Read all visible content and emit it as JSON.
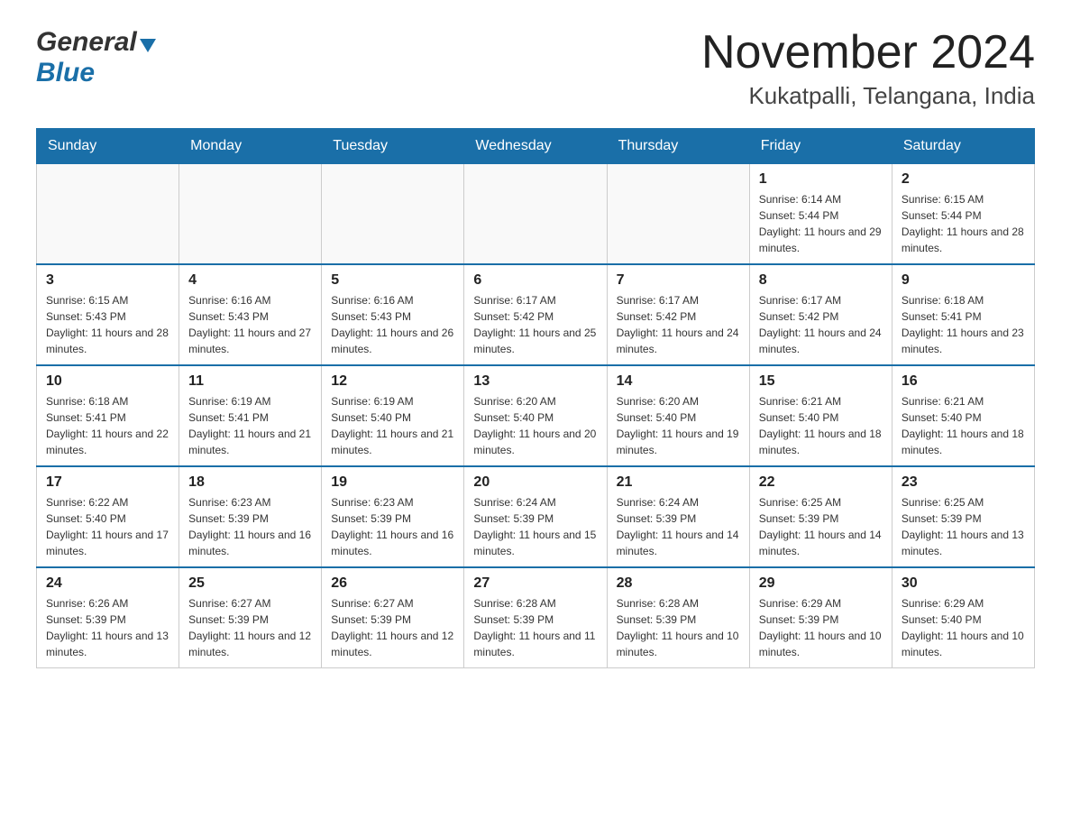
{
  "header": {
    "logo_general": "General",
    "logo_blue": "Blue",
    "month_title": "November 2024",
    "location": "Kukatpalli, Telangana, India"
  },
  "calendar": {
    "days_of_week": [
      "Sunday",
      "Monday",
      "Tuesday",
      "Wednesday",
      "Thursday",
      "Friday",
      "Saturday"
    ],
    "weeks": [
      [
        {
          "day": "",
          "info": ""
        },
        {
          "day": "",
          "info": ""
        },
        {
          "day": "",
          "info": ""
        },
        {
          "day": "",
          "info": ""
        },
        {
          "day": "",
          "info": ""
        },
        {
          "day": "1",
          "info": "Sunrise: 6:14 AM\nSunset: 5:44 PM\nDaylight: 11 hours and 29 minutes."
        },
        {
          "day": "2",
          "info": "Sunrise: 6:15 AM\nSunset: 5:44 PM\nDaylight: 11 hours and 28 minutes."
        }
      ],
      [
        {
          "day": "3",
          "info": "Sunrise: 6:15 AM\nSunset: 5:43 PM\nDaylight: 11 hours and 28 minutes."
        },
        {
          "day": "4",
          "info": "Sunrise: 6:16 AM\nSunset: 5:43 PM\nDaylight: 11 hours and 27 minutes."
        },
        {
          "day": "5",
          "info": "Sunrise: 6:16 AM\nSunset: 5:43 PM\nDaylight: 11 hours and 26 minutes."
        },
        {
          "day": "6",
          "info": "Sunrise: 6:17 AM\nSunset: 5:42 PM\nDaylight: 11 hours and 25 minutes."
        },
        {
          "day": "7",
          "info": "Sunrise: 6:17 AM\nSunset: 5:42 PM\nDaylight: 11 hours and 24 minutes."
        },
        {
          "day": "8",
          "info": "Sunrise: 6:17 AM\nSunset: 5:42 PM\nDaylight: 11 hours and 24 minutes."
        },
        {
          "day": "9",
          "info": "Sunrise: 6:18 AM\nSunset: 5:41 PM\nDaylight: 11 hours and 23 minutes."
        }
      ],
      [
        {
          "day": "10",
          "info": "Sunrise: 6:18 AM\nSunset: 5:41 PM\nDaylight: 11 hours and 22 minutes."
        },
        {
          "day": "11",
          "info": "Sunrise: 6:19 AM\nSunset: 5:41 PM\nDaylight: 11 hours and 21 minutes."
        },
        {
          "day": "12",
          "info": "Sunrise: 6:19 AM\nSunset: 5:40 PM\nDaylight: 11 hours and 21 minutes."
        },
        {
          "day": "13",
          "info": "Sunrise: 6:20 AM\nSunset: 5:40 PM\nDaylight: 11 hours and 20 minutes."
        },
        {
          "day": "14",
          "info": "Sunrise: 6:20 AM\nSunset: 5:40 PM\nDaylight: 11 hours and 19 minutes."
        },
        {
          "day": "15",
          "info": "Sunrise: 6:21 AM\nSunset: 5:40 PM\nDaylight: 11 hours and 18 minutes."
        },
        {
          "day": "16",
          "info": "Sunrise: 6:21 AM\nSunset: 5:40 PM\nDaylight: 11 hours and 18 minutes."
        }
      ],
      [
        {
          "day": "17",
          "info": "Sunrise: 6:22 AM\nSunset: 5:40 PM\nDaylight: 11 hours and 17 minutes."
        },
        {
          "day": "18",
          "info": "Sunrise: 6:23 AM\nSunset: 5:39 PM\nDaylight: 11 hours and 16 minutes."
        },
        {
          "day": "19",
          "info": "Sunrise: 6:23 AM\nSunset: 5:39 PM\nDaylight: 11 hours and 16 minutes."
        },
        {
          "day": "20",
          "info": "Sunrise: 6:24 AM\nSunset: 5:39 PM\nDaylight: 11 hours and 15 minutes."
        },
        {
          "day": "21",
          "info": "Sunrise: 6:24 AM\nSunset: 5:39 PM\nDaylight: 11 hours and 14 minutes."
        },
        {
          "day": "22",
          "info": "Sunrise: 6:25 AM\nSunset: 5:39 PM\nDaylight: 11 hours and 14 minutes."
        },
        {
          "day": "23",
          "info": "Sunrise: 6:25 AM\nSunset: 5:39 PM\nDaylight: 11 hours and 13 minutes."
        }
      ],
      [
        {
          "day": "24",
          "info": "Sunrise: 6:26 AM\nSunset: 5:39 PM\nDaylight: 11 hours and 13 minutes."
        },
        {
          "day": "25",
          "info": "Sunrise: 6:27 AM\nSunset: 5:39 PM\nDaylight: 11 hours and 12 minutes."
        },
        {
          "day": "26",
          "info": "Sunrise: 6:27 AM\nSunset: 5:39 PM\nDaylight: 11 hours and 12 minutes."
        },
        {
          "day": "27",
          "info": "Sunrise: 6:28 AM\nSunset: 5:39 PM\nDaylight: 11 hours and 11 minutes."
        },
        {
          "day": "28",
          "info": "Sunrise: 6:28 AM\nSunset: 5:39 PM\nDaylight: 11 hours and 10 minutes."
        },
        {
          "day": "29",
          "info": "Sunrise: 6:29 AM\nSunset: 5:39 PM\nDaylight: 11 hours and 10 minutes."
        },
        {
          "day": "30",
          "info": "Sunrise: 6:29 AM\nSunset: 5:40 PM\nDaylight: 11 hours and 10 minutes."
        }
      ]
    ]
  }
}
